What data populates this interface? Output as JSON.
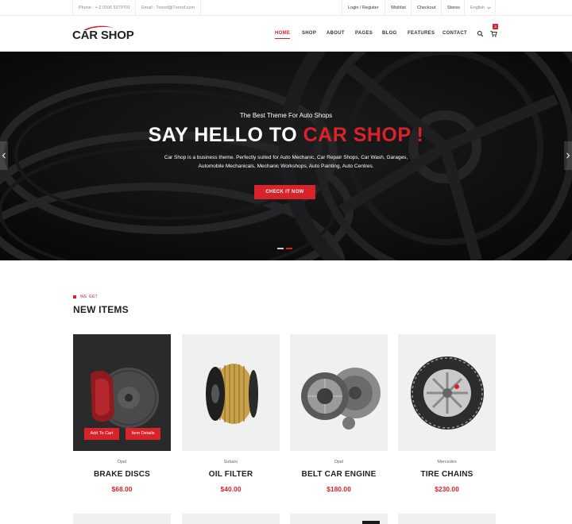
{
  "topbar": {
    "phone": "Phone : + 2 0106 5370701",
    "email": "Email : 7oroof@7oroof.com",
    "login": "Login / Register",
    "wishlist": "Wishlist",
    "checkout": "Checkout",
    "stores": "Stores",
    "language": "English"
  },
  "header": {
    "logo": "CAR SHOP",
    "nav": [
      "HOME",
      "SHOP",
      "ABOUT",
      "PAGES",
      "BLOG",
      "FEATURES",
      "CONTACT"
    ],
    "active_nav": "HOME",
    "cart_count": "3"
  },
  "hero": {
    "subtitle": "The Best Theme For Auto Shops",
    "title_white": "SAY HELLO TO ",
    "title_red": "CAR SHOP !",
    "description": "Car Shop is a business theme. Perfectly suited for Auto Mechanic, Car Repair Shops, Car Wash, Garages, Automobile Mechanicals, Mechanic Workshops, Auto Painting, Auto Centres.",
    "button": "CHECK IT NOW",
    "slide_count": 2,
    "active_slide": 2
  },
  "section": {
    "kicker": "WE GET",
    "title": "NEW ITEMS"
  },
  "products": [
    {
      "brand": "Opel",
      "name": "BRAKE DISCS",
      "price": "$68.00",
      "icon": "brake-disc-image",
      "hovered": true
    },
    {
      "brand": "Subaru",
      "name": "OIL FILTER",
      "price": "$40.00",
      "icon": "oil-filter-image",
      "hovered": false
    },
    {
      "brand": "Opel",
      "name": "BELT CAR ENGINE",
      "price": "$180.00",
      "icon": "clutch-kit-image",
      "hovered": false
    },
    {
      "brand": "Mercedes",
      "name": "TIRE CHAINS",
      "price": "$230.00",
      "icon": "tire-chain-image",
      "hovered": false
    }
  ],
  "card_actions": {
    "add_to_cart": "Add To Cart",
    "item_details": "Item Details"
  },
  "colors": {
    "accent": "#d8232a",
    "dark": "#222222",
    "hero_bg": "#1b1b1d"
  }
}
